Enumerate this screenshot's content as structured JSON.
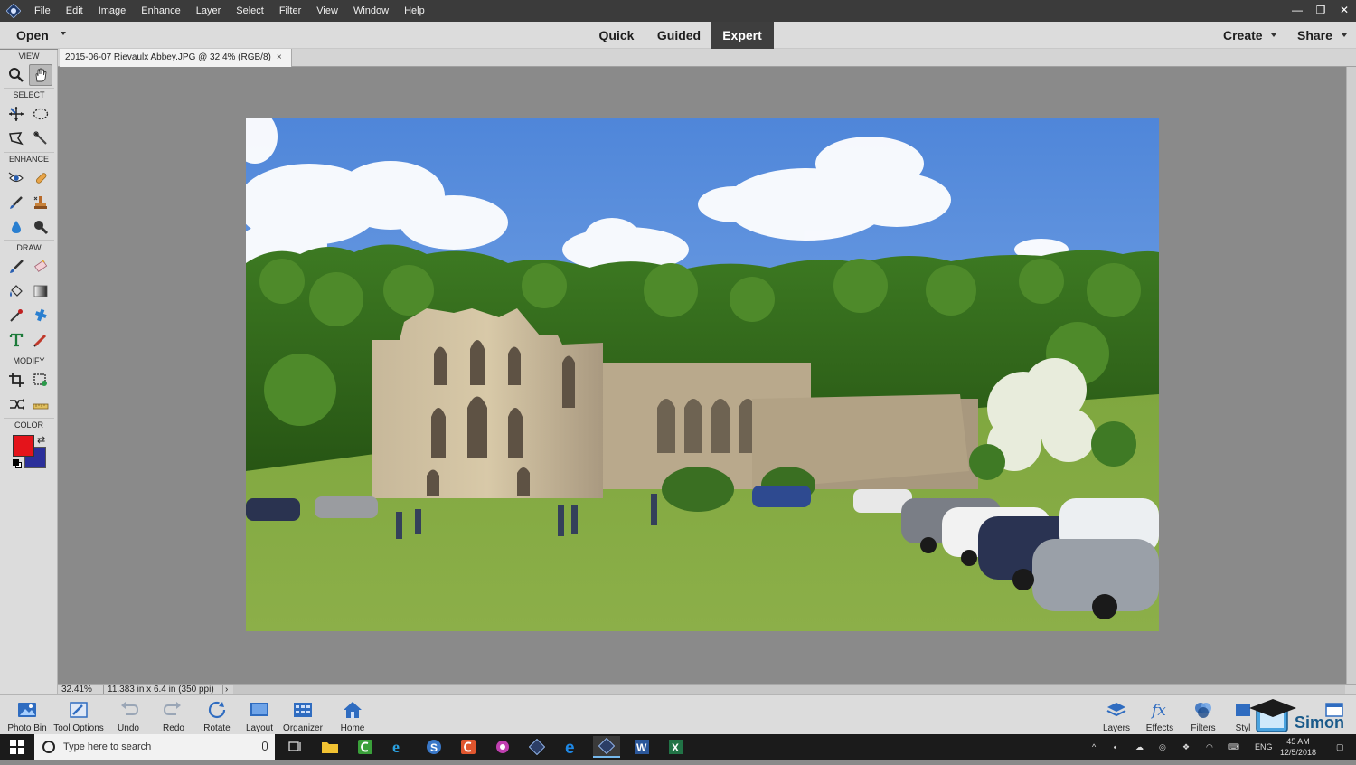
{
  "app": {
    "menu": [
      "File",
      "Edit",
      "Image",
      "Enhance",
      "Layer",
      "Select",
      "Filter",
      "View",
      "Window",
      "Help"
    ],
    "window_controls": [
      "—",
      "❐",
      "✕"
    ]
  },
  "modebar": {
    "open_label": "Open",
    "modes": [
      "Quick",
      "Guided",
      "Expert"
    ],
    "active_mode": "Expert",
    "create_label": "Create",
    "share_label": "Share"
  },
  "toolbox": {
    "sections": [
      "VIEW",
      "SELECT",
      "ENHANCE",
      "DRAW",
      "MODIFY",
      "COLOR"
    ],
    "colors": {
      "foreground": "#e4141b",
      "background": "#2b2f9a"
    }
  },
  "document": {
    "tab_title": "2015-06-07 Rievaulx Abbey.JPG @ 32.4% (RGB/8)",
    "tab_close": "×"
  },
  "status": {
    "zoom": "32.41%",
    "dimensions": "11.383 in x 6.4 in (350 ppi)",
    "arrow": "›"
  },
  "panelbar": {
    "left": [
      {
        "label": "Photo Bin",
        "icon": "photo-bin-icon"
      },
      {
        "label": "Tool Options",
        "icon": "tool-options-icon"
      },
      {
        "label": "Undo",
        "icon": "undo-icon"
      },
      {
        "label": "Redo",
        "icon": "redo-icon"
      },
      {
        "label": "Rotate",
        "icon": "rotate-icon"
      },
      {
        "label": "Layout",
        "icon": "layout-icon"
      },
      {
        "label": "Organizer",
        "icon": "organizer-icon"
      },
      {
        "label": "Home Screen",
        "icon": "home-screen-icon"
      }
    ],
    "right": [
      {
        "label": "Layers",
        "icon": "layers-icon"
      },
      {
        "label": "Effects",
        "icon": "effects-icon"
      },
      {
        "label": "Filters",
        "icon": "filters-icon"
      },
      {
        "label": "Styl",
        "icon": "styles-icon"
      }
    ]
  },
  "taskbar": {
    "search_placeholder": "Type here to search",
    "tray_lang": "ENG",
    "clock_time": "45 AM",
    "clock_date": "12/5/2018"
  },
  "watermark": {
    "text": "Simon"
  }
}
